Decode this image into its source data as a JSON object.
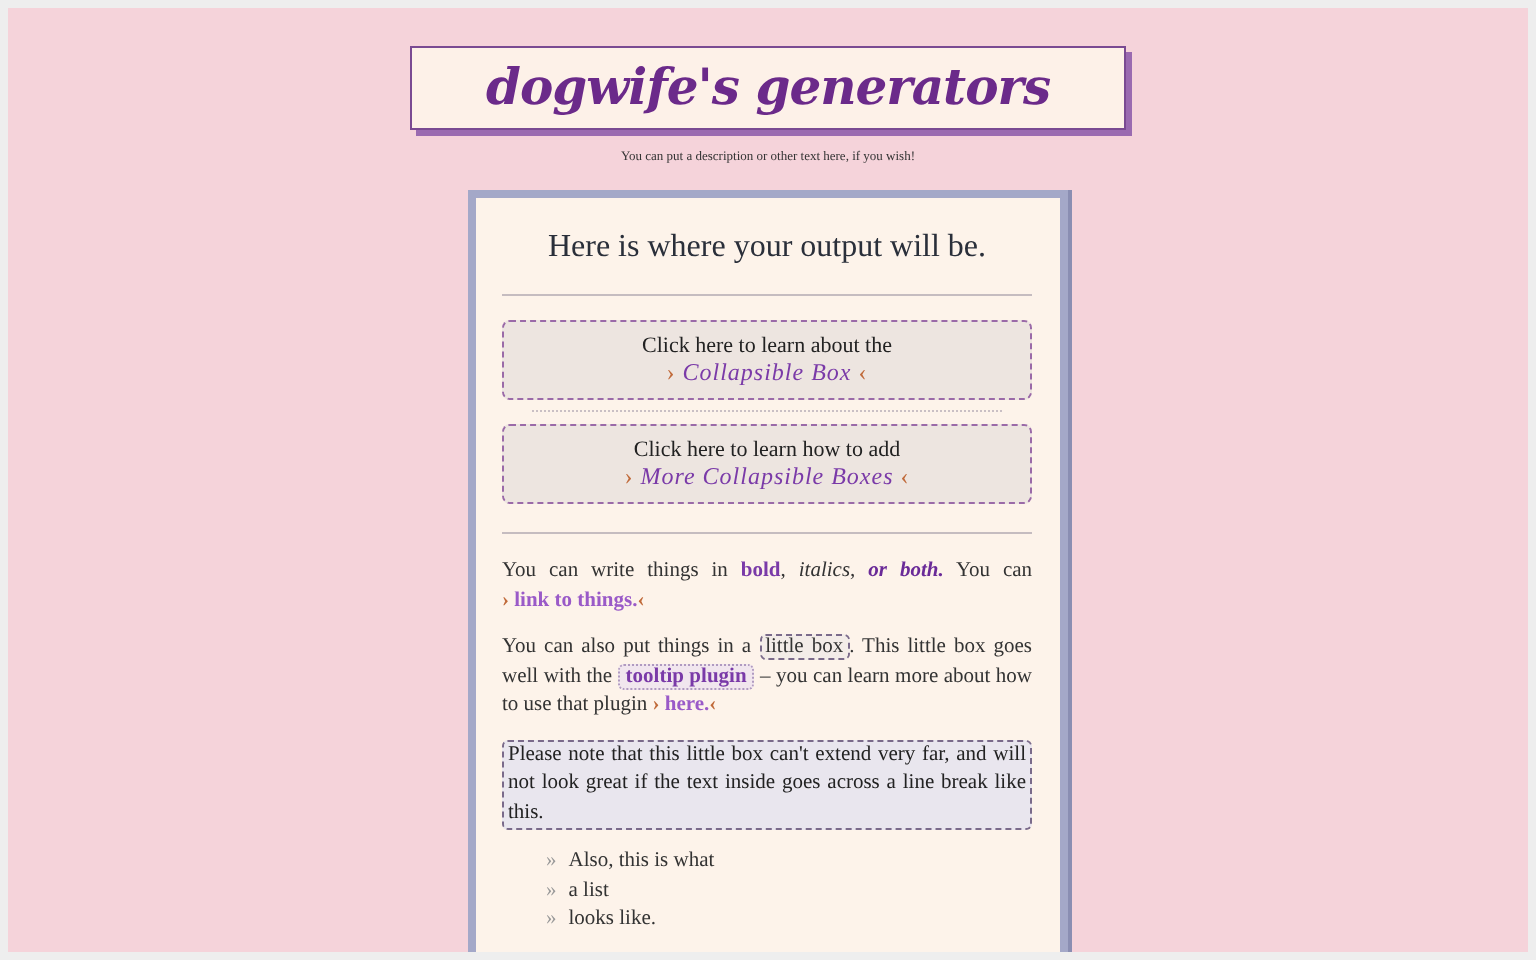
{
  "header": {
    "title": "dogwife's generators",
    "description": "You can put a description or other text here, if you wish!"
  },
  "output": {
    "text": "Here is where your output will be."
  },
  "collapsibles": [
    {
      "text": "Click here to learn about the",
      "link": "Collapsible Box",
      "open_mark": "›",
      "close_mark": "‹",
      "expanded": false
    },
    {
      "text": "Click here to learn how to add",
      "link": "More Collapsible Boxes",
      "open_mark": "›",
      "close_mark": "‹",
      "expanded": false
    }
  ],
  "paragraphs": [
    [
      {
        "kind": "text",
        "text": "You can write things in "
      },
      {
        "kind": "bold",
        "text": "bold"
      },
      {
        "kind": "text",
        "text": ", "
      },
      {
        "kind": "italic",
        "text": "italics"
      },
      {
        "kind": "text",
        "text": ", "
      },
      {
        "kind": "bolditalic",
        "text": "or both."
      },
      {
        "kind": "text",
        "text": " You can "
      },
      {
        "kind": "link",
        "pre": "›",
        "text": "link to things.",
        "post": "‹"
      }
    ],
    [
      {
        "kind": "text",
        "text": "You can also put things in a "
      },
      {
        "kind": "box",
        "text": "little box"
      },
      {
        "kind": "text",
        "text": ". This little box goes well with the "
      },
      {
        "kind": "tooltip",
        "text": "tooltip plugin"
      },
      {
        "kind": "text",
        "text": " – you can learn more about how to use that plugin "
      },
      {
        "kind": "link",
        "pre": "›",
        "text": "here.",
        "post": "‹"
      }
    ],
    [
      {
        "kind": "box",
        "text": "Please note that this little box can't extend very far, and will not look great if the text inside goes across a line break like this."
      }
    ]
  ],
  "list": {
    "marker": "»",
    "items": [
      "Also, this is what",
      "a list",
      "looks like."
    ]
  }
}
